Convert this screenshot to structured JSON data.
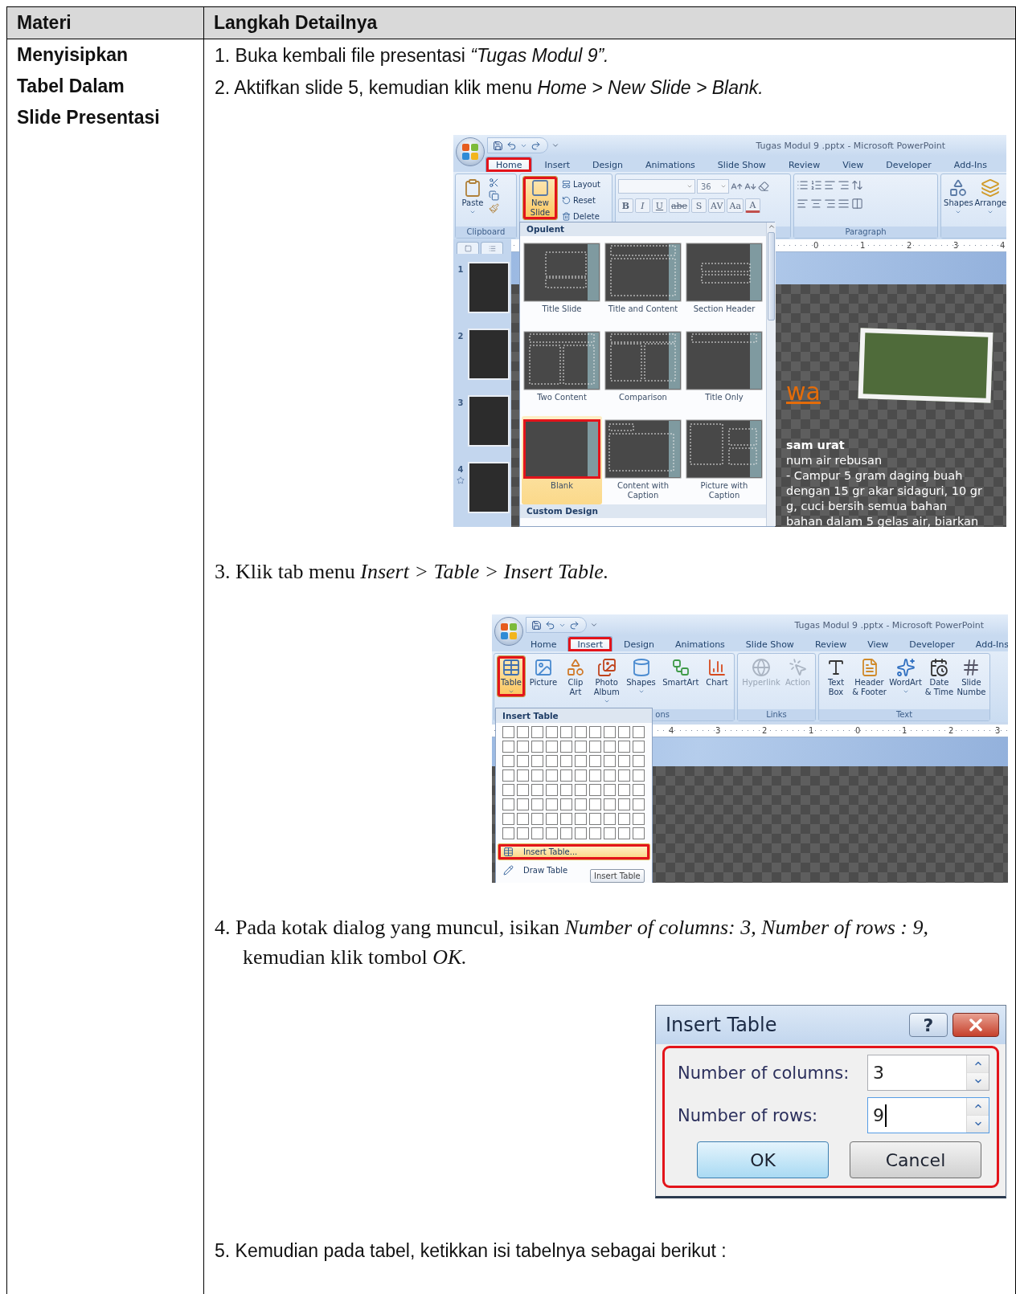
{
  "table": {
    "columns": [
      "Materi",
      "Langkah Detailnya"
    ],
    "topic": "Menyisipkan Tabel Dalam Slide Presentasi",
    "steps": [
      {
        "kind": "text",
        "number": "1.",
        "text": "Buka kembali file presentasi *“Tugas Modul 9”.*"
      },
      {
        "kind": "text",
        "number": "2.",
        "text": "Aktifkan slide 5, kemudian klik  menu *Home > New Slide > Blank.*"
      },
      {
        "kind": "ppt-home",
        "title": "Tugas Modul 9 .pptx - Microsoft PowerPoint",
        "tabs": [
          {
            "label": "Home",
            "selected": true,
            "highlighted": true
          },
          {
            "label": "Insert",
            "selected": false,
            "highlighted": false
          },
          {
            "label": "Design",
            "selected": false,
            "highlighted": false
          },
          {
            "label": "Animations",
            "selected": false,
            "highlighted": false
          },
          {
            "label": "Slide Show",
            "selected": false,
            "highlighted": false
          },
          {
            "label": "Review",
            "selected": false,
            "highlighted": false
          },
          {
            "label": "View",
            "selected": false,
            "highlighted": false
          },
          {
            "label": "Developer",
            "selected": false,
            "highlighted": false
          },
          {
            "label": "Add-Ins",
            "selected": false,
            "highlighted": false
          }
        ],
        "paste": "Paste",
        "new_slide": {
          "lines": [
            "New",
            "Slide"
          ],
          "pressed": true,
          "highlighted": true
        },
        "slide_commands": [
          "Layout",
          "Reset",
          "Delete"
        ],
        "font_size": "36",
        "font_buttons": [
          "B",
          "I",
          "U",
          "abe",
          "S",
          "AV",
          "Aa",
          "A"
        ],
        "drawing_buttons": [
          "Shapes",
          "Arrange"
        ],
        "group_labels": [
          "Clipboard",
          "Paragraph"
        ],
        "gallery": {
          "theme": "Opulent",
          "footer": "Custom Design",
          "layouts": [
            {
              "label": "Title Slide",
              "selected": false,
              "highlighted": false
            },
            {
              "label": "Title and Content",
              "selected": false,
              "highlighted": false
            },
            {
              "label": "Section Header",
              "selected": false,
              "highlighted": false
            },
            {
              "label": "Two Content",
              "selected": false,
              "highlighted": false
            },
            {
              "label": "Comparison",
              "selected": false,
              "highlighted": false
            },
            {
              "label": "Title Only",
              "selected": false,
              "highlighted": false
            },
            {
              "label": "Blank",
              "selected": true,
              "highlighted": true
            },
            {
              "label": "Content with Caption",
              "selected": false,
              "highlighted": false
            },
            {
              "label": "Picture with Caption",
              "selected": false,
              "highlighted": false
            }
          ]
        },
        "slides": [
          {
            "number": "1",
            "animated": false
          },
          {
            "number": "2",
            "animated": false
          },
          {
            "number": "3",
            "animated": false
          },
          {
            "number": "4",
            "animated": true
          }
        ],
        "ruler": [
          "0",
          "1",
          "2",
          "3",
          "4"
        ],
        "slide_title": "wa",
        "slide_lines": [
          {
            "text": "sam urat",
            "bold": true
          },
          {
            "text": "num air rebusan",
            "bold": false
          },
          {
            "text": "- Campur 5 gram daging buah",
            "bold": false
          },
          {
            "text": "dengan 15 gr akar sidaguri, 10 gr",
            "bold": false
          },
          {
            "text": "g, cuci bersih semua bahan",
            "bold": false
          },
          {
            "text": "bahan dalam 5 gelas air, biarkan",
            "bold": false
          }
        ]
      },
      {
        "kind": "text",
        "number": "3.",
        "text": "Klik tab menu *Insert > Table > Insert Table.*"
      },
      {
        "kind": "ppt-insert",
        "title": "Tugas Modul 9 .pptx - Microsoft PowerPoint",
        "tabs": [
          {
            "label": "Home",
            "selected": false,
            "highlighted": false
          },
          {
            "label": "Insert",
            "selected": true,
            "highlighted": true
          },
          {
            "label": "Design",
            "selected": false,
            "highlighted": false
          },
          {
            "label": "Animations",
            "selected": false,
            "highlighted": false
          },
          {
            "label": "Slide Show",
            "selected": false,
            "highlighted": false
          },
          {
            "label": "Review",
            "selected": false,
            "highlighted": false
          },
          {
            "label": "View",
            "selected": false,
            "highlighted": false
          },
          {
            "label": "Developer",
            "selected": false,
            "highlighted": false
          },
          {
            "label": "Add-Ins",
            "selected": false,
            "highlighted": false
          }
        ],
        "groups": [
          {
            "label": "ons",
            "buttons": [
              {
                "lines": [
                  "Table"
                ],
                "menu": true,
                "pressed": true,
                "highlighted": true,
                "disabled": false
              },
              {
                "lines": [
                  "Picture"
                ],
                "menu": false,
                "pressed": false,
                "highlighted": false,
                "disabled": false
              },
              {
                "lines": [
                  "Clip",
                  "Art"
                ],
                "menu": false,
                "pressed": false,
                "highlighted": false,
                "disabled": false
              },
              {
                "lines": [
                  "Photo",
                  "Album"
                ],
                "menu": true,
                "pressed": false,
                "highlighted": false,
                "disabled": false
              },
              {
                "lines": [
                  "Shapes"
                ],
                "menu": true,
                "pressed": false,
                "highlighted": false,
                "disabled": false
              },
              {
                "lines": [
                  "SmartArt"
                ],
                "menu": false,
                "pressed": false,
                "highlighted": false,
                "disabled": false
              },
              {
                "lines": [
                  "Chart"
                ],
                "menu": false,
                "pressed": false,
                "highlighted": false,
                "disabled": false
              }
            ]
          },
          {
            "label": "Links",
            "buttons": [
              {
                "lines": [
                  "Hyperlink"
                ],
                "menu": false,
                "pressed": false,
                "highlighted": false,
                "disabled": true
              },
              {
                "lines": [
                  "Action"
                ],
                "menu": false,
                "pressed": false,
                "highlighted": false,
                "disabled": true
              }
            ]
          },
          {
            "label": "Text",
            "buttons": [
              {
                "lines": [
                  "Text",
                  "Box"
                ],
                "menu": false,
                "pressed": false,
                "highlighted": false,
                "disabled": false
              },
              {
                "lines": [
                  "Header",
                  "& Footer"
                ],
                "menu": false,
                "pressed": false,
                "highlighted": false,
                "disabled": false
              },
              {
                "lines": [
                  "WordArt"
                ],
                "menu": true,
                "pressed": false,
                "highlighted": false,
                "disabled": false
              },
              {
                "lines": [
                  "Date",
                  "& Time"
                ],
                "menu": false,
                "pressed": false,
                "highlighted": false,
                "disabled": false
              },
              {
                "lines": [
                  "Slide",
                  "Numbe"
                ],
                "menu": false,
                "pressed": false,
                "highlighted": false,
                "disabled": false
              }
            ]
          }
        ],
        "ruler": [
          "4",
          "3",
          "2",
          "1",
          "0",
          "1",
          "2",
          "3"
        ],
        "menu": {
          "title": "Insert Table",
          "items": [
            {
              "label": "Insert Table...",
              "selected": true,
              "highlighted": true
            },
            {
              "label": "Draw Table",
              "selected": false,
              "highlighted": false
            }
          ]
        },
        "tooltip": "Insert Table"
      },
      {
        "kind": "text",
        "number": "4.",
        "text": "Pada kotak dialog yang muncul, isikan *Number of columns: 3, Number of rows : 9,* kemudian klik tombol *OK.*"
      },
      {
        "kind": "dialog",
        "title": "Insert Table",
        "help": "?",
        "highlighted": true,
        "fields": [
          {
            "label": "Number of columns:",
            "value": "3",
            "focused": false
          },
          {
            "label": "Number of rows:",
            "value": "9",
            "focused": true
          }
        ],
        "buttons": [
          {
            "label": "OK",
            "default": true
          },
          {
            "label": "Cancel",
            "default": false
          }
        ]
      },
      {
        "kind": "text",
        "number": "5.",
        "text": "Kemudian pada tabel, ketikkan isi tabelnya sebagai berikut :"
      }
    ]
  }
}
